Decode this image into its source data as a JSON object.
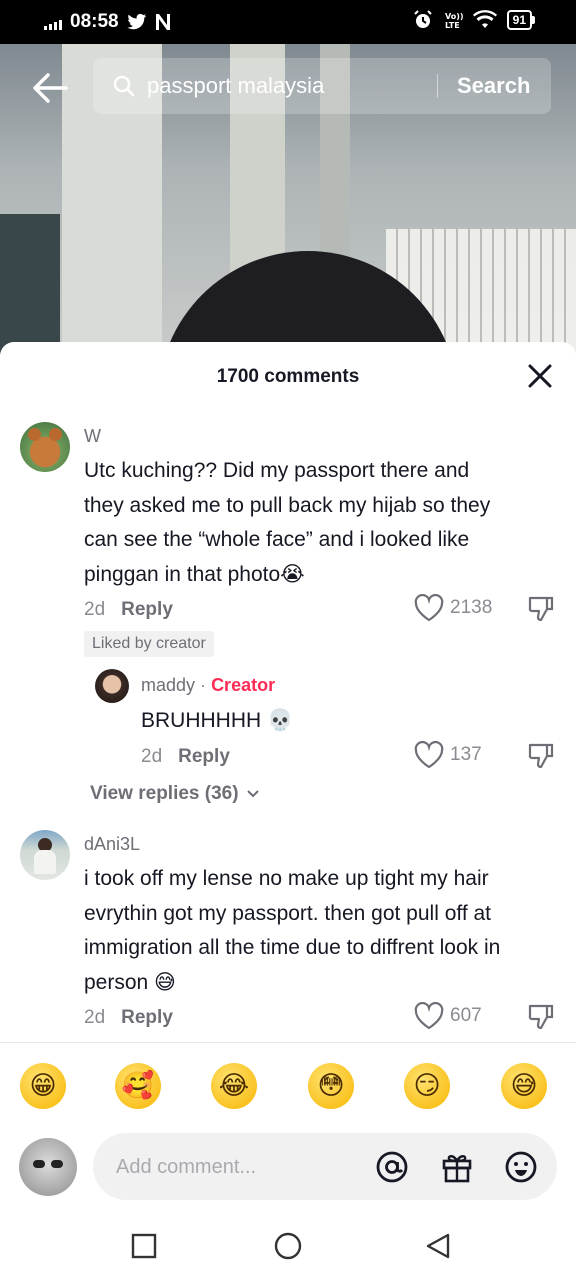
{
  "status_bar": {
    "time": "08:58",
    "battery": "91"
  },
  "search": {
    "query": "passport malaysia",
    "search_label": "Search"
  },
  "comments_sheet": {
    "title": "1700 comments",
    "comments": [
      {
        "username": "W",
        "text": "Utc kuching?? Did my passport there and they asked me to pull back my hijab so they can see the “whole face” and i looked like pinggan in that photo😭",
        "age": "2d",
        "reply_label": "Reply",
        "likes": "2138",
        "badge": "Liked by creator"
      },
      {
        "username": "dAni3L",
        "text": "i took off my lense no make up tight my hair evrythin got my passport. then got pull off at immigration all the time due to diffrent look in person 😅",
        "age": "2d",
        "reply_label": "Reply",
        "likes": "607"
      }
    ],
    "reply": {
      "username": "maddy",
      "separator": "·",
      "creator_label": "Creator",
      "text": "BRUHHHHH 💀",
      "age": "2d",
      "reply_label": "Reply",
      "likes": "137"
    },
    "view_replies": "View replies (36)"
  },
  "emoji_bar": [
    "grinning",
    "smiling-hearts",
    "joy",
    "flushed",
    "smirk",
    "sweat-smile"
  ],
  "composer": {
    "placeholder": "Add comment..."
  },
  "colors": {
    "accent": "#fe2c55",
    "text": "#161823",
    "muted": "#8a8b91"
  }
}
